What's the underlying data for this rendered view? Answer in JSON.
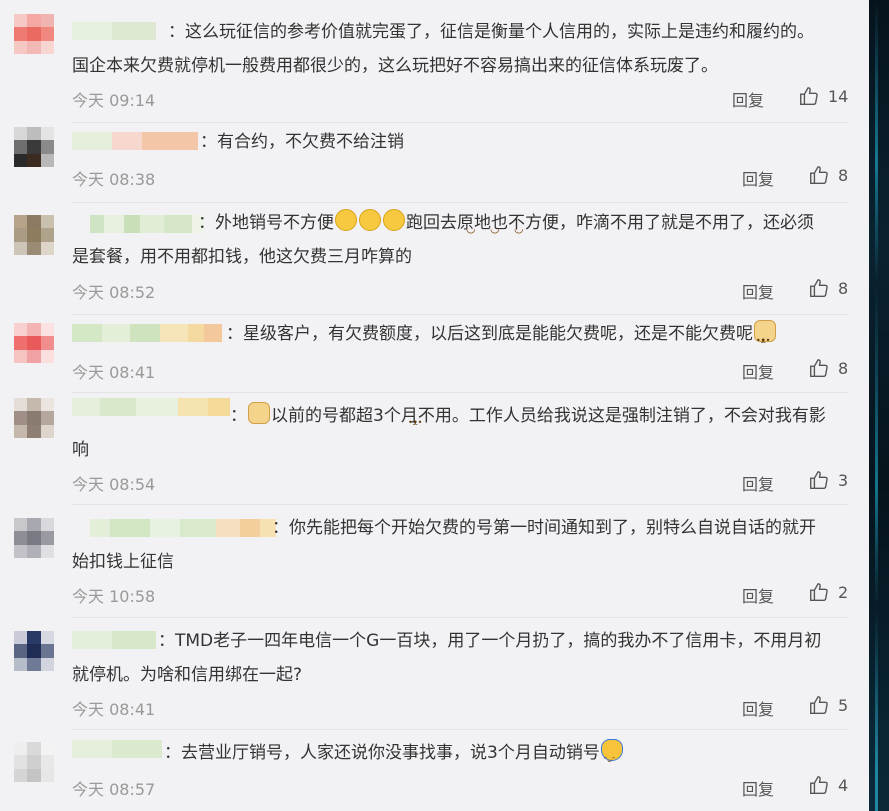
{
  "comments": [
    {
      "text": "：这么玩征信的参考价值就完蛋了，征信是衡量个人信用的，实际上是违约和履约的。国企本来欠费就停机一般费用都很少的，这么玩把好不容易搞出来的征信体系玩废了。",
      "time": "今天 09:14",
      "reply": "回复",
      "likes": "14"
    },
    {
      "text": "：有合约，不欠费不给注销",
      "time": "今天 08:38",
      "reply": "回复",
      "likes": "8"
    },
    {
      "text_a": "：外地销号不方便",
      "text_b": "跑回去原地也不方便，咋滴不用了就是不用了，还必须是套餐，用不用都扣钱，他这欠费三月咋算的",
      "time": "今天 08:52",
      "reply": "回复",
      "likes": "8"
    },
    {
      "text": "：星级客户，有欠费额度，以后这到底是能能欠费呢，还是不能欠费呢",
      "time": "今天 08:41",
      "reply": "回复",
      "likes": "8"
    },
    {
      "text_a": "：",
      "text_b": "以前的号都超3个月不用。工作人员给我说这是强制注销了，不会对我有影响",
      "time": "今天 08:54",
      "reply": "回复",
      "likes": "3"
    },
    {
      "text": "：你先能把每个开始欠费的号第一时间通知到了，别特么自说自话的就开始扣钱上征信",
      "time": "今天 10:58",
      "reply": "回复",
      "likes": "2"
    },
    {
      "text": "：TMD老子一四年电信一个G一百块，用了一个月扔了，搞的我办不了信用卡，不用月初就停机。为啥和信用绑在一起?",
      "time": "今天 08:41",
      "reply": "回复",
      "likes": "5"
    },
    {
      "text": "：去营业厅销号，人家还说你没事找事，说3个月自动销号",
      "time": "今天 08:57",
      "reply": "回复",
      "likes": "4"
    }
  ],
  "icons": {
    "like": "thumbs-up-icon",
    "emoji_face": "upside-down-face-emoji",
    "emoji_doge": "doge-emoji",
    "emoji_hug": "hug-emoji"
  },
  "colors": {
    "background": "#f2f2f5",
    "time": "#999999",
    "text": "#333333"
  }
}
